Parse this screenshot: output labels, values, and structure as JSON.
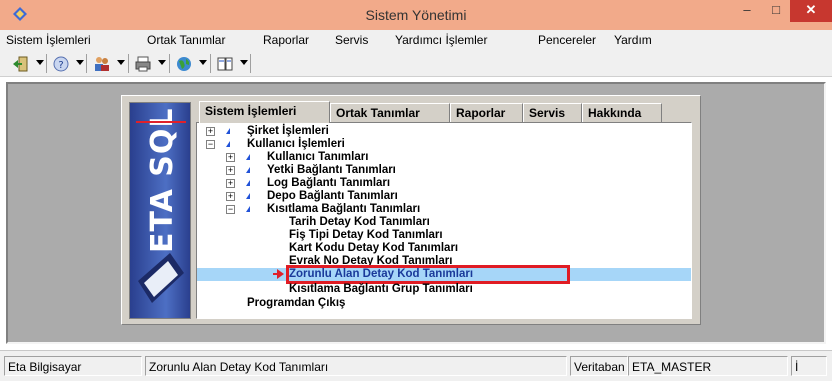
{
  "window": {
    "title": "Sistem Yönetimi"
  },
  "controls": {
    "minimize": "–",
    "maximize": "□",
    "close": "✕"
  },
  "menubar": {
    "items": [
      "Sistem İşlemleri",
      "Ortak Tanımlar",
      "Raporlar",
      "Servis",
      "Yardımcı İşlemler",
      "Pencereler",
      "Yardım"
    ]
  },
  "toolbar": {
    "buttons": [
      "exit-icon",
      "help-icon",
      "users-icon",
      "printer-icon",
      "globe-icon",
      "window-icon"
    ]
  },
  "dialog": {
    "tabs": [
      "Sistem İşlemleri",
      "Ortak Tanımlar",
      "Raporlar",
      "Servis",
      "Hakkında"
    ],
    "active_tab": "Sistem İşlemleri",
    "logo_text": "ETA SQL"
  },
  "tree": {
    "nodes": [
      {
        "label": "Şirket İşlemleri",
        "level": 0,
        "expander": "+",
        "marker": true
      },
      {
        "label": "Kullanıcı İşlemleri",
        "level": 0,
        "expander": "−",
        "marker": true
      },
      {
        "label": "Kullanıcı Tanımları",
        "level": 1,
        "expander": "+",
        "marker": true
      },
      {
        "label": "Yetki Bağlantı Tanımları",
        "level": 1,
        "expander": "+",
        "marker": true
      },
      {
        "label": "Log Bağlantı Tanımları",
        "level": 1,
        "expander": "+",
        "marker": true
      },
      {
        "label": "Depo Bağlantı Tanımları",
        "level": 1,
        "expander": "+",
        "marker": true
      },
      {
        "label": "Kısıtlama Bağlantı Tanımları",
        "level": 1,
        "expander": "−",
        "marker": true
      },
      {
        "label": "Tarih Detay Kod Tanımları",
        "level": 2
      },
      {
        "label": "Fiş Tipi Detay  Kod Tanımları",
        "level": 2
      },
      {
        "label": "Kart Kodu Detay Kod Tanımları",
        "level": 2
      },
      {
        "label": "Evrak No Detay Kod Tanımları",
        "level": 2
      },
      {
        "label": "Zorunlu Alan Detay Kod Tanımları",
        "level": 2,
        "selected": true
      },
      {
        "label": "Kısıtlama Bağlantı Grup Tanımları",
        "level": 2
      },
      {
        "label": "Programdan Çıkış",
        "level": 0
      }
    ]
  },
  "statusbar": {
    "company": "Eta Bilgisayar",
    "current_item": "Zorunlu Alan Detay Kod Tanımları",
    "db_label": "Veritaban",
    "db_name": "ETA_MASTER",
    "extra": "İ"
  },
  "colors": {
    "titlebar": "#f2aa8a",
    "close_button": "#c7372f",
    "selection": "#a6d6f8",
    "highlight_box": "#e01c24",
    "tree_marker": "#2152d8"
  }
}
